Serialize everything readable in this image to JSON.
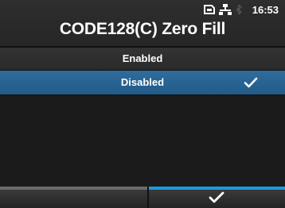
{
  "status": {
    "time": "16:53",
    "icons": [
      "sd-card-icon",
      "network-icon",
      "wireless-icon"
    ]
  },
  "header": {
    "title": "CODE128(C) Zero Fill"
  },
  "options": [
    {
      "label": "Enabled",
      "selected": false
    },
    {
      "label": "Disabled",
      "selected": true
    }
  ],
  "footer": {
    "left_button": "back-button",
    "right_button": "confirm-button"
  },
  "colors": {
    "selection": "#2a6496",
    "accent": "#1a9be0",
    "background": "#1b1b1b"
  }
}
